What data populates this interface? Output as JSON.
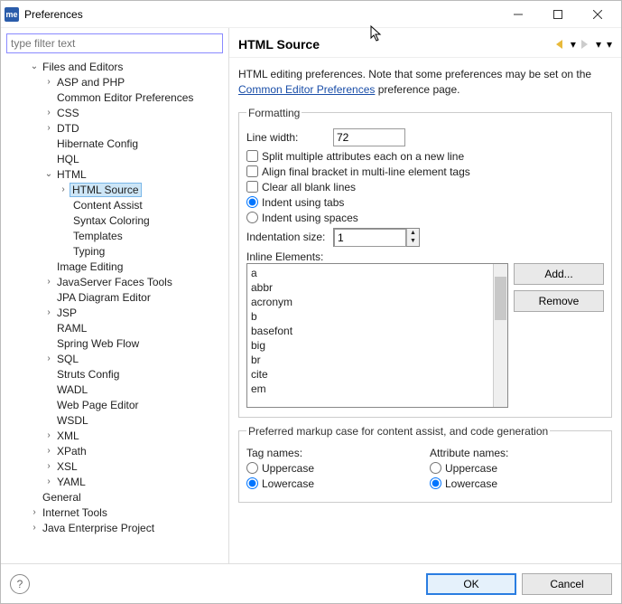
{
  "window": {
    "title": "Preferences",
    "appIconText": "me"
  },
  "filter": {
    "placeholder": "type filter text"
  },
  "tree": {
    "t0": "Files and Editors",
    "t1": "ASP and PHP",
    "t2": "Common Editor Preferences",
    "t3": "CSS",
    "t4": "DTD",
    "t5": "Hibernate Config",
    "t6": "HQL",
    "t7": "HTML",
    "t8": "HTML Source",
    "t9": "Content Assist",
    "t10": "Syntax Coloring",
    "t11": "Templates",
    "t12": "Typing",
    "t13": "Image Editing",
    "t14": "JavaServer Faces Tools",
    "t15": "JPA Diagram Editor",
    "t16": "JSP",
    "t17": "RAML",
    "t18": "Spring Web Flow",
    "t19": "SQL",
    "t20": "Struts Config",
    "t21": "WADL",
    "t22": "Web Page Editor",
    "t23": "WSDL",
    "t24": "XML",
    "t25": "XPath",
    "t26": "XSL",
    "t27": "YAML",
    "t28": "General",
    "t29": "Internet Tools",
    "t30": "Java Enterprise Project"
  },
  "page": {
    "title": "HTML Source",
    "desc1": "HTML editing preferences.  Note that some preferences may be set on the ",
    "descLink": "Common Editor Preferences",
    "desc2": " preference page."
  },
  "formatting": {
    "legend": "Formatting",
    "lineWidthLabel": "Line width:",
    "lineWidth": "72",
    "splitAttrs": "Split multiple attributes each on a new line",
    "alignBracket": "Align final bracket in multi-line element tags",
    "clearBlank": "Clear all blank lines",
    "indentTabs": "Indent using tabs",
    "indentSpaces": "Indent using spaces",
    "indentSizeLabel": "Indentation size:",
    "indentSize": "1",
    "inlineLabel": "Inline Elements:",
    "inline": [
      "a",
      "abbr",
      "acronym",
      "b",
      "basefont",
      "big",
      "br",
      "cite",
      "em"
    ],
    "addBtn": "Add...",
    "removeBtn": "Remove"
  },
  "case": {
    "legend": "Preferred markup case for content assist, and code generation",
    "tagLabel": "Tag names:",
    "attrLabel": "Attribute names:",
    "upper": "Uppercase",
    "lower": "Lowercase"
  },
  "footer": {
    "ok": "OK",
    "cancel": "Cancel"
  }
}
